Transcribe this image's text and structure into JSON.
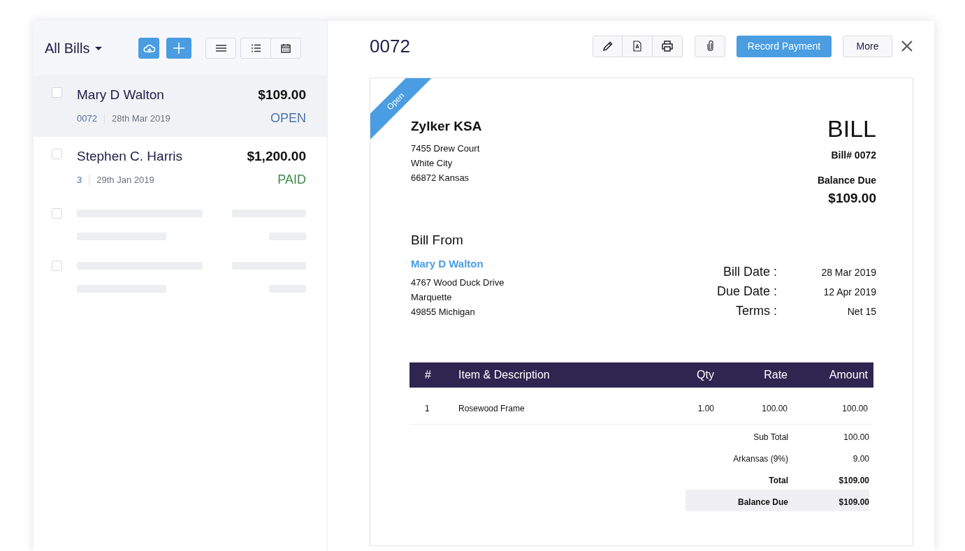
{
  "sidebar": {
    "title": "All Bills",
    "bills": [
      {
        "kind": "bill",
        "selected": true,
        "checked": false,
        "name": "Mary D Walton",
        "amount": "$109.00",
        "number": "0072",
        "date": "28th Mar 2019",
        "status": "OPEN",
        "color": "#4a74a8"
      },
      {
        "kind": "bill",
        "selected": false,
        "checked": false,
        "name": "Stephen C. Harris",
        "amount": "$1,200.00",
        "number": "3",
        "date": "29th Jan 2019",
        "status": "PAID",
        "color": "#3f8a4a"
      },
      {
        "kind": "placeholder",
        "checked": false
      },
      {
        "kind": "placeholder",
        "checked": false
      }
    ]
  },
  "detail": {
    "title": "0072",
    "record_button": "Record Payment",
    "more_button": "More"
  },
  "document": {
    "ribbon": "Open",
    "company": "Zylker KSA",
    "company_address": [
      "7455 Drew Court",
      "White City",
      "66872 Kansas"
    ],
    "doc_title": "BILL",
    "bill_number": "Bill# 0072",
    "balance_label": "Balance Due",
    "balance": "$109.00",
    "bill_from_label": "Bill From",
    "vendor": "Mary D Walton",
    "vendor_address": [
      "4767 Wood Duck Drive",
      "Marquette",
      "49855 Michigan"
    ],
    "meta": [
      {
        "label": "Bill Date :",
        "value": "28 Mar 2019"
      },
      {
        "label": "Due Date :",
        "value": "12 Apr 2019"
      },
      {
        "label": "Terms :",
        "value": "Net 15"
      }
    ],
    "table": {
      "columns": [
        "#",
        "Item & Description",
        "Qty",
        "Rate",
        "Amount"
      ],
      "rows": [
        [
          "1",
          "Rosewood Frame",
          "1.00",
          "100.00",
          "100.00"
        ]
      ]
    },
    "totals": [
      {
        "kind": "plain",
        "label": "Sub Total",
        "value": "100.00"
      },
      {
        "kind": "plain",
        "label": "Arkansas (9%)",
        "value": "9.00"
      },
      {
        "kind": "bold",
        "label": "Total",
        "value": "$109.00"
      },
      {
        "kind": "highlight",
        "label": "Balance Due",
        "value": "$109.00"
      }
    ]
  }
}
